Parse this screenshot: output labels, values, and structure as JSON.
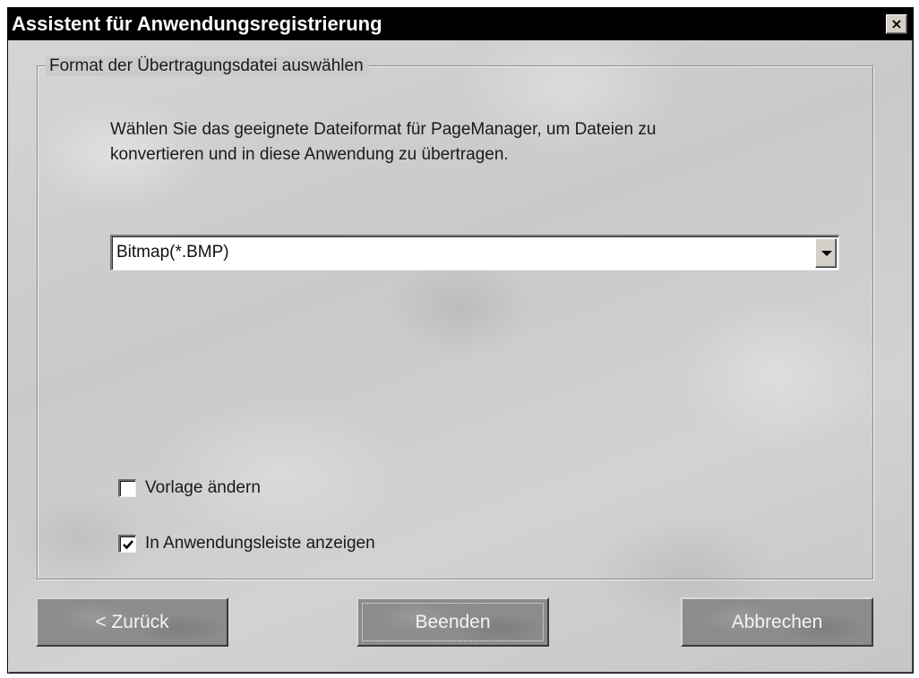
{
  "window": {
    "title": "Assistent für Anwendungsregistrierung",
    "close_glyph": "×"
  },
  "group": {
    "legend": "Format der Übertragungsdatei auswählen",
    "instruction_line1": "Wählen Sie das geeignete Dateiformat für PageManager, um Dateien zu",
    "instruction_line2": "konvertieren und in diese Anwendung zu übertragen."
  },
  "format_select": {
    "selected": "Bitmap(*.BMP)"
  },
  "options": {
    "change_template": {
      "label": "Vorlage ändern",
      "checked": false
    },
    "show_in_app_bar": {
      "label": "In Anwendungsleiste anzeigen",
      "checked": true
    }
  },
  "buttons": {
    "back": "< Zurück",
    "finish": "Beenden",
    "cancel": "Abbrechen"
  },
  "icons": {
    "close": "close-icon",
    "dropdown": "chevron-down-icon",
    "check": "checkmark-icon"
  }
}
